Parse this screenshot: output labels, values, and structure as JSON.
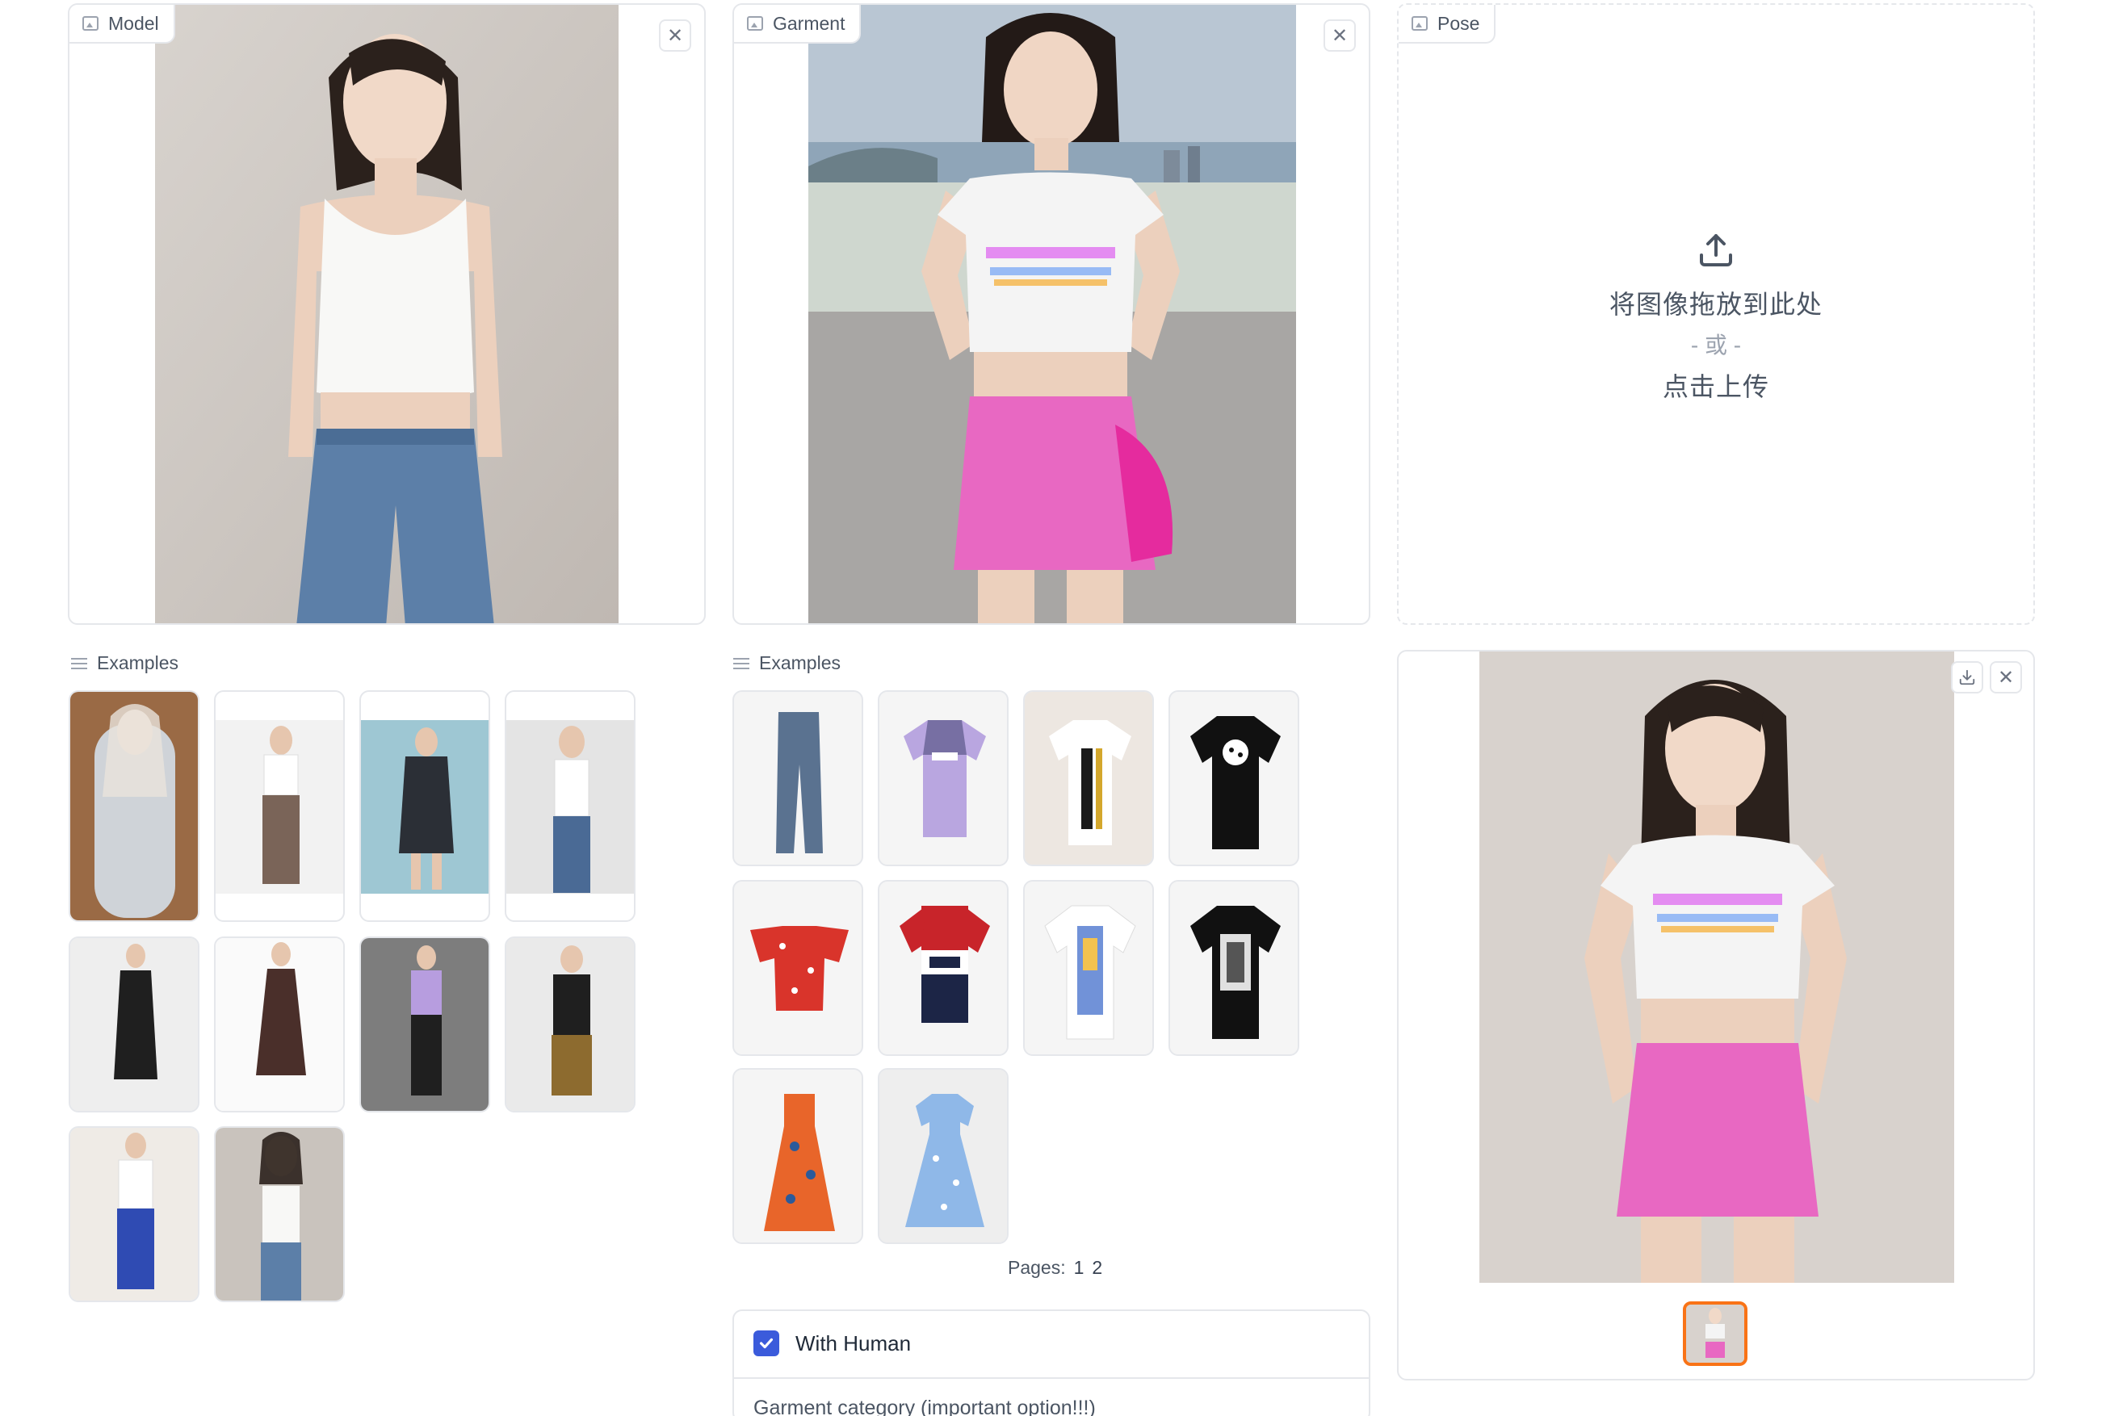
{
  "model_panel": {
    "label": "Model",
    "close_icon": "close-icon",
    "image_icon": "image-icon"
  },
  "garment_panel": {
    "label": "Garment",
    "close_icon": "close-icon",
    "image_icon": "image-icon"
  },
  "pose_panel": {
    "label": "Pose",
    "upload_text": "将图像拖放到此处",
    "or_text": "- 或 -",
    "click_text": "点击上传",
    "upload_icon": "upload-icon"
  },
  "model_examples": {
    "header": "Examples",
    "items": [
      "fantasy-armor-woman",
      "pants-outfit",
      "sequin-dress",
      "man-white-tank",
      "black-slip-dress",
      "brown-ruffle-dress",
      "purple-tee-leggings",
      "black-top-leopard-skirt",
      "ax-tee-blue-pants",
      "white-tank-jeans"
    ]
  },
  "garment_examples": {
    "header": "Examples",
    "items": [
      "ripped-jeans",
      "vans-lavender-tee",
      "armani-tee",
      "dalmatian-black-tee",
      "red-floral-top",
      "fila-tee",
      "printed-white-tee",
      "idont-care-black-tee",
      "orange-print-dress",
      "blue-floral-dress"
    ],
    "pages_label": "Pages:",
    "pages": [
      "1",
      "2"
    ]
  },
  "options": {
    "with_human_label": "With Human",
    "with_human_checked": true,
    "garment_category_label": "Garment category (important option!!!)"
  },
  "output_panel": {
    "download_icon": "download-icon",
    "close_icon": "close-icon"
  },
  "colors": {
    "accent": "#3b5bdb",
    "border": "#e5e7eb",
    "thumb_selected": "#f97316"
  }
}
